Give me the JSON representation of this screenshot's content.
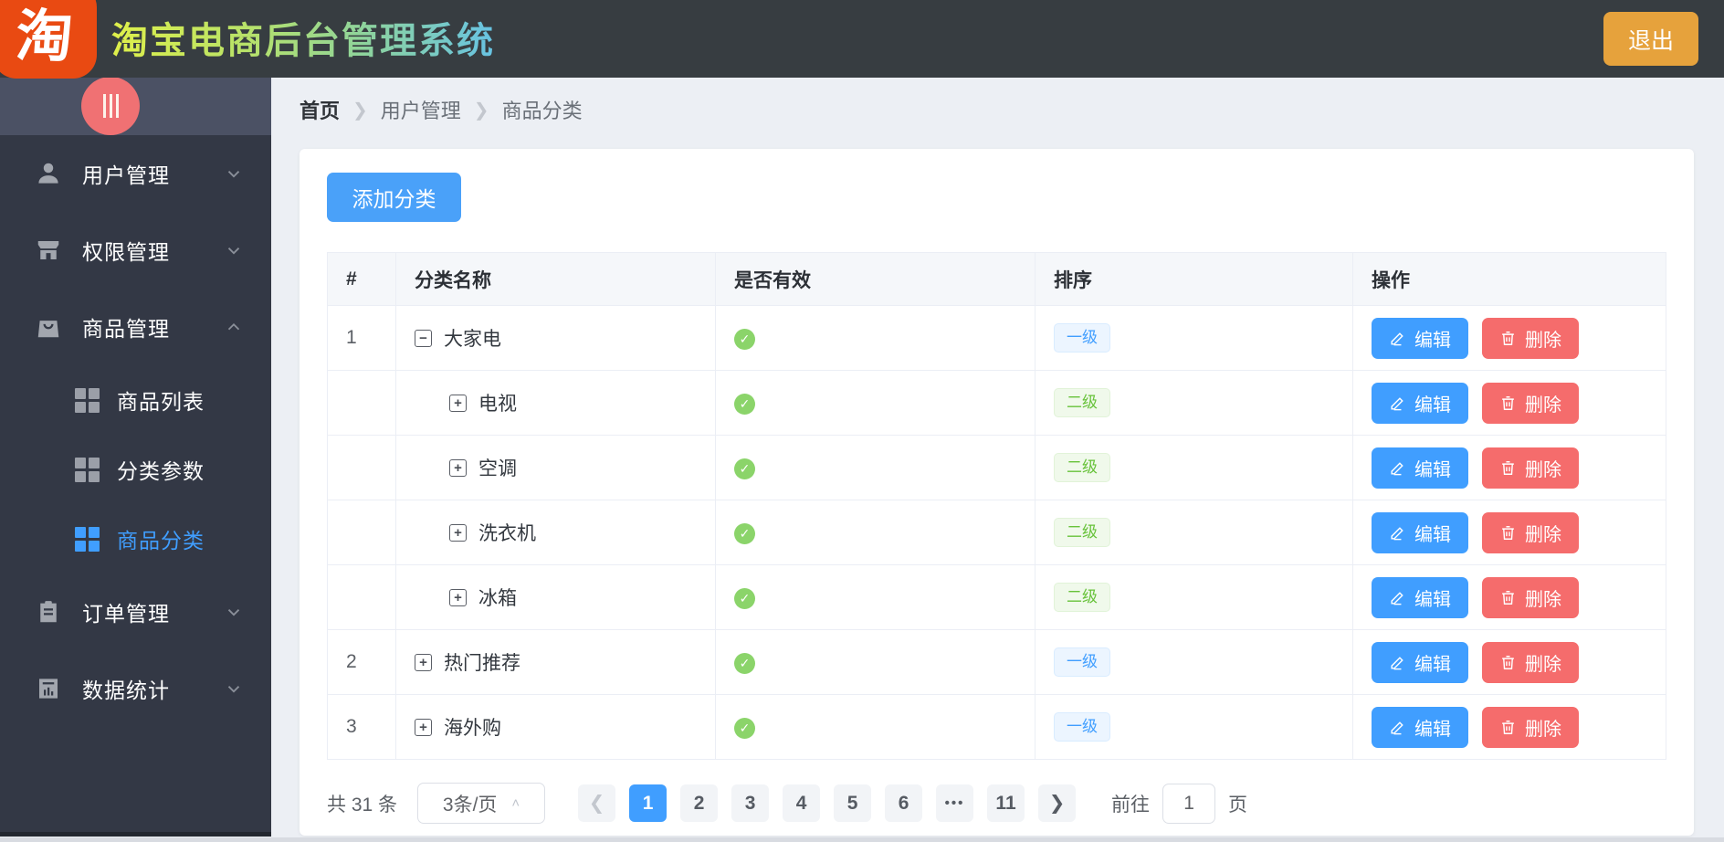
{
  "header": {
    "logo_char": "淘",
    "title": "淘宝电商后台管理系统",
    "logout_label": "退出"
  },
  "sidebar": {
    "toggle_icon": "triple-bar",
    "items": [
      {
        "label": "用户管理",
        "icon": "user-icon",
        "state": "collapsed"
      },
      {
        "label": "权限管理",
        "icon": "shop-icon",
        "state": "collapsed"
      },
      {
        "label": "商品管理",
        "icon": "bag-icon",
        "state": "expanded",
        "children": [
          {
            "label": "商品列表",
            "active": false
          },
          {
            "label": "分类参数",
            "active": false
          },
          {
            "label": "商品分类",
            "active": true
          }
        ]
      },
      {
        "label": "订单管理",
        "icon": "clipboard-icon",
        "state": "collapsed"
      },
      {
        "label": "数据统计",
        "icon": "stats-icon",
        "state": "collapsed"
      }
    ]
  },
  "breadcrumb": [
    "首页",
    "用户管理",
    "商品分类"
  ],
  "toolbar": {
    "add_button_label": "添加分类"
  },
  "table": {
    "columns": [
      "#",
      "分类名称",
      "是否有效",
      "排序",
      "操作"
    ],
    "edit_label": "编辑",
    "delete_label": "删除",
    "rows": [
      {
        "index": "1",
        "name": "大家电",
        "expander": "minus",
        "depth": 1,
        "valid": true,
        "level": "一级",
        "level_color": "blue"
      },
      {
        "index": "",
        "name": "电视",
        "expander": "plus",
        "depth": 2,
        "valid": true,
        "level": "二级",
        "level_color": "green"
      },
      {
        "index": "",
        "name": "空调",
        "expander": "plus",
        "depth": 2,
        "valid": true,
        "level": "二级",
        "level_color": "green"
      },
      {
        "index": "",
        "name": "洗衣机",
        "expander": "plus",
        "depth": 2,
        "valid": true,
        "level": "二级",
        "level_color": "green"
      },
      {
        "index": "",
        "name": "冰箱",
        "expander": "plus",
        "depth": 2,
        "valid": true,
        "level": "二级",
        "level_color": "green"
      },
      {
        "index": "2",
        "name": "热门推荐",
        "expander": "plus",
        "depth": 1,
        "valid": true,
        "level": "一级",
        "level_color": "blue"
      },
      {
        "index": "3",
        "name": "海外购",
        "expander": "plus",
        "depth": 1,
        "valid": true,
        "level": "一级",
        "level_color": "blue"
      }
    ]
  },
  "pagination": {
    "total_label": "共 31 条",
    "page_size_value": "3条/页",
    "pages": [
      "1",
      "2",
      "3",
      "4",
      "5",
      "6",
      "•••",
      "11"
    ],
    "active_page": "1",
    "goto_label": "前往",
    "goto_value": "1",
    "goto_suffix": "页"
  },
  "colors": {
    "primary": "#409eff",
    "danger": "#f56c6c",
    "success": "#67c23a",
    "warning": "#e6a23c",
    "brand_orange": "#e94a12",
    "sidebar_bg": "#333845",
    "header_bg": "#373d41",
    "toggle_red": "#f07173"
  }
}
